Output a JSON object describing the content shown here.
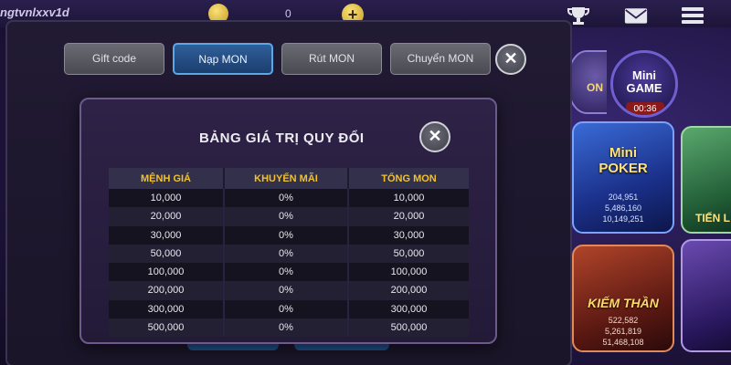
{
  "topbar": {
    "username": "ngtvnlxxv1d",
    "balance": "0",
    "plus": "+"
  },
  "tabs": [
    {
      "label": "Gift code"
    },
    {
      "label": "Nạp MON"
    },
    {
      "label": "Rút MON"
    },
    {
      "label": "Chuyển MON"
    }
  ],
  "close_glyph": "✕",
  "dialog": {
    "title": "BẢNG GIÁ TRỊ QUY ĐỔI",
    "close_glyph": "✕",
    "columns": [
      "MỆNH GIÁ",
      "KHUYẾN MÃI",
      "TỔNG MON"
    ],
    "rows": [
      [
        "10,000",
        "0%",
        "10,000"
      ],
      [
        "20,000",
        "0%",
        "20,000"
      ],
      [
        "30,000",
        "0%",
        "30,000"
      ],
      [
        "50,000",
        "0%",
        "50,000"
      ],
      [
        "100,000",
        "0%",
        "100,000"
      ],
      [
        "200,000",
        "0%",
        "200,000"
      ],
      [
        "300,000",
        "0%",
        "300,000"
      ],
      [
        "500,000",
        "0%",
        "500,000"
      ]
    ]
  },
  "games": {
    "partial_top": "ON",
    "minigame": {
      "title_1": "Mini",
      "title_2": "GAME",
      "timer": "00:36"
    },
    "poker": {
      "title_1": "Mini",
      "title_2": "POKER",
      "stats": [
        "204,951",
        "5,486,160",
        "10,149,251"
      ]
    },
    "tienlen": "TIẾN L",
    "kiem": {
      "title": "KIẾM THẦN",
      "stats": [
        "522,582",
        "5,261,819",
        "51,468,108"
      ]
    }
  },
  "colors": {
    "accent_gold": "#f2c22a",
    "active_tab": "#2f5f9a",
    "panel_bg": "#211a33"
  },
  "icons": [
    "coin-icon",
    "plus-icon",
    "trophy-icon",
    "mail-icon",
    "menu-icon",
    "close-icon"
  ]
}
